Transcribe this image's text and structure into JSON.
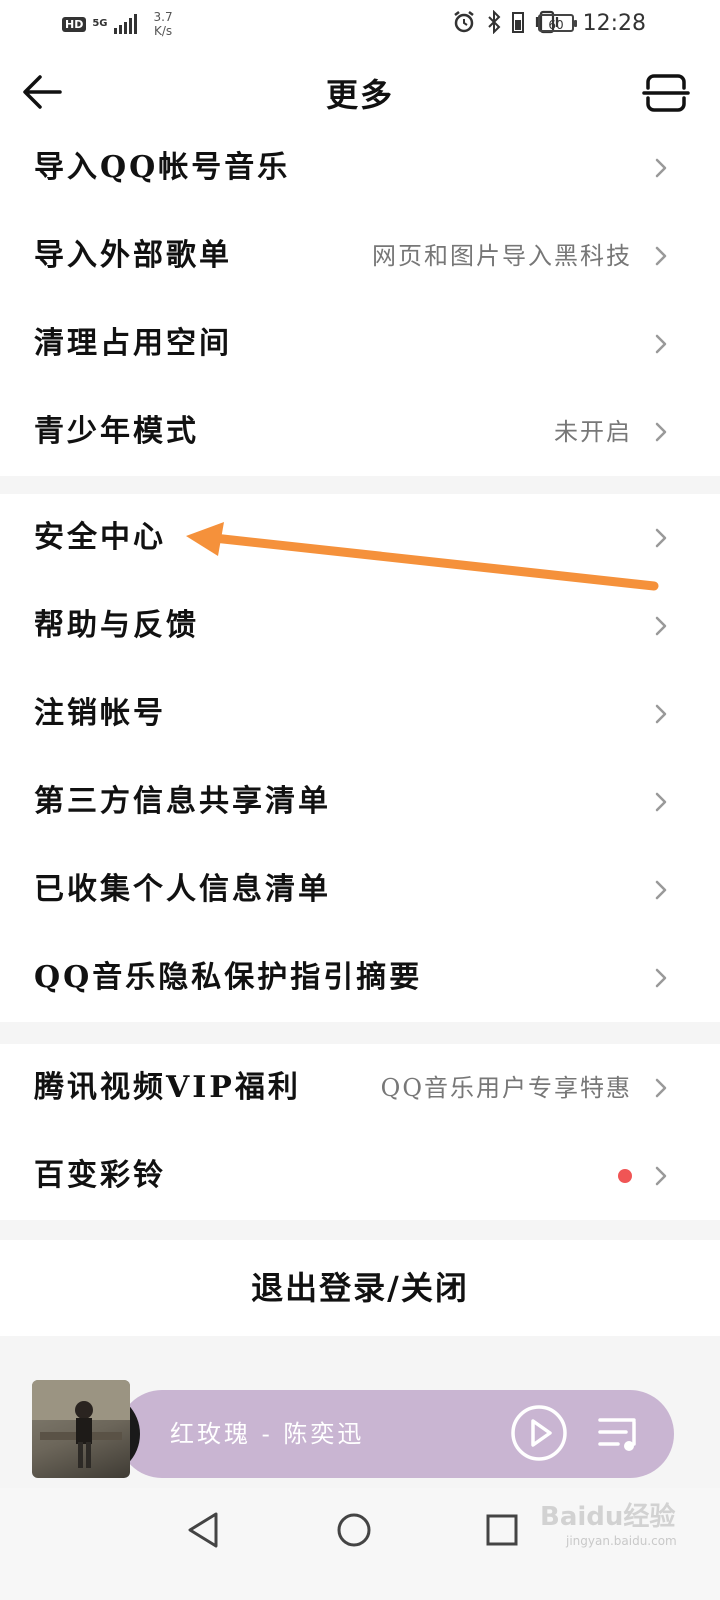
{
  "status_bar": {
    "hd": "HD",
    "network": "5G",
    "speed_value": "3.7",
    "speed_unit": "K/s",
    "battery": "60",
    "time": "12:28",
    "icons": [
      "alarm-icon",
      "bluetooth-icon",
      "vibrate-icon",
      "battery-icon"
    ]
  },
  "header": {
    "title": "更多",
    "back_icon": "back-arrow-icon",
    "scan_icon": "scan-icon"
  },
  "groups": [
    {
      "items": [
        {
          "label": "导入QQ帐号音乐",
          "sub": ""
        },
        {
          "label": "导入外部歌单",
          "sub": "网页和图片导入黑科技"
        },
        {
          "label": "清理占用空间",
          "sub": ""
        },
        {
          "label": "青少年模式",
          "sub": "未开启"
        }
      ]
    },
    {
      "items": [
        {
          "label": "安全中心",
          "sub": ""
        },
        {
          "label": "帮助与反馈",
          "sub": ""
        },
        {
          "label": "注销帐号",
          "sub": ""
        },
        {
          "label": "第三方信息共享清单",
          "sub": ""
        },
        {
          "label": "已收集个人信息清单",
          "sub": ""
        },
        {
          "label": "QQ音乐隐私保护指引摘要",
          "sub": ""
        }
      ]
    },
    {
      "items": [
        {
          "label": "腾讯视频VIP福利",
          "sub": "QQ音乐用户专享特惠"
        },
        {
          "label": "百变彩铃",
          "sub": "",
          "badge": "red-dot"
        }
      ]
    }
  ],
  "logout": {
    "label": "退出登录/关闭"
  },
  "player": {
    "song": "红玫瑰 - 陈奕迅",
    "play_icon": "play-icon",
    "playlist_icon": "playlist-icon"
  },
  "nav_bar": {
    "icons": [
      "nav-back-icon",
      "nav-home-icon",
      "nav-recent-icon"
    ]
  },
  "watermark": {
    "text": "Baidu经验",
    "sub": "jingyan.baidu.com"
  },
  "colors": {
    "accent_annotation": "#f5913b",
    "player_bg": "#c9b5d2",
    "badge": "#f05555",
    "page_bg": "#f5f5f5"
  }
}
